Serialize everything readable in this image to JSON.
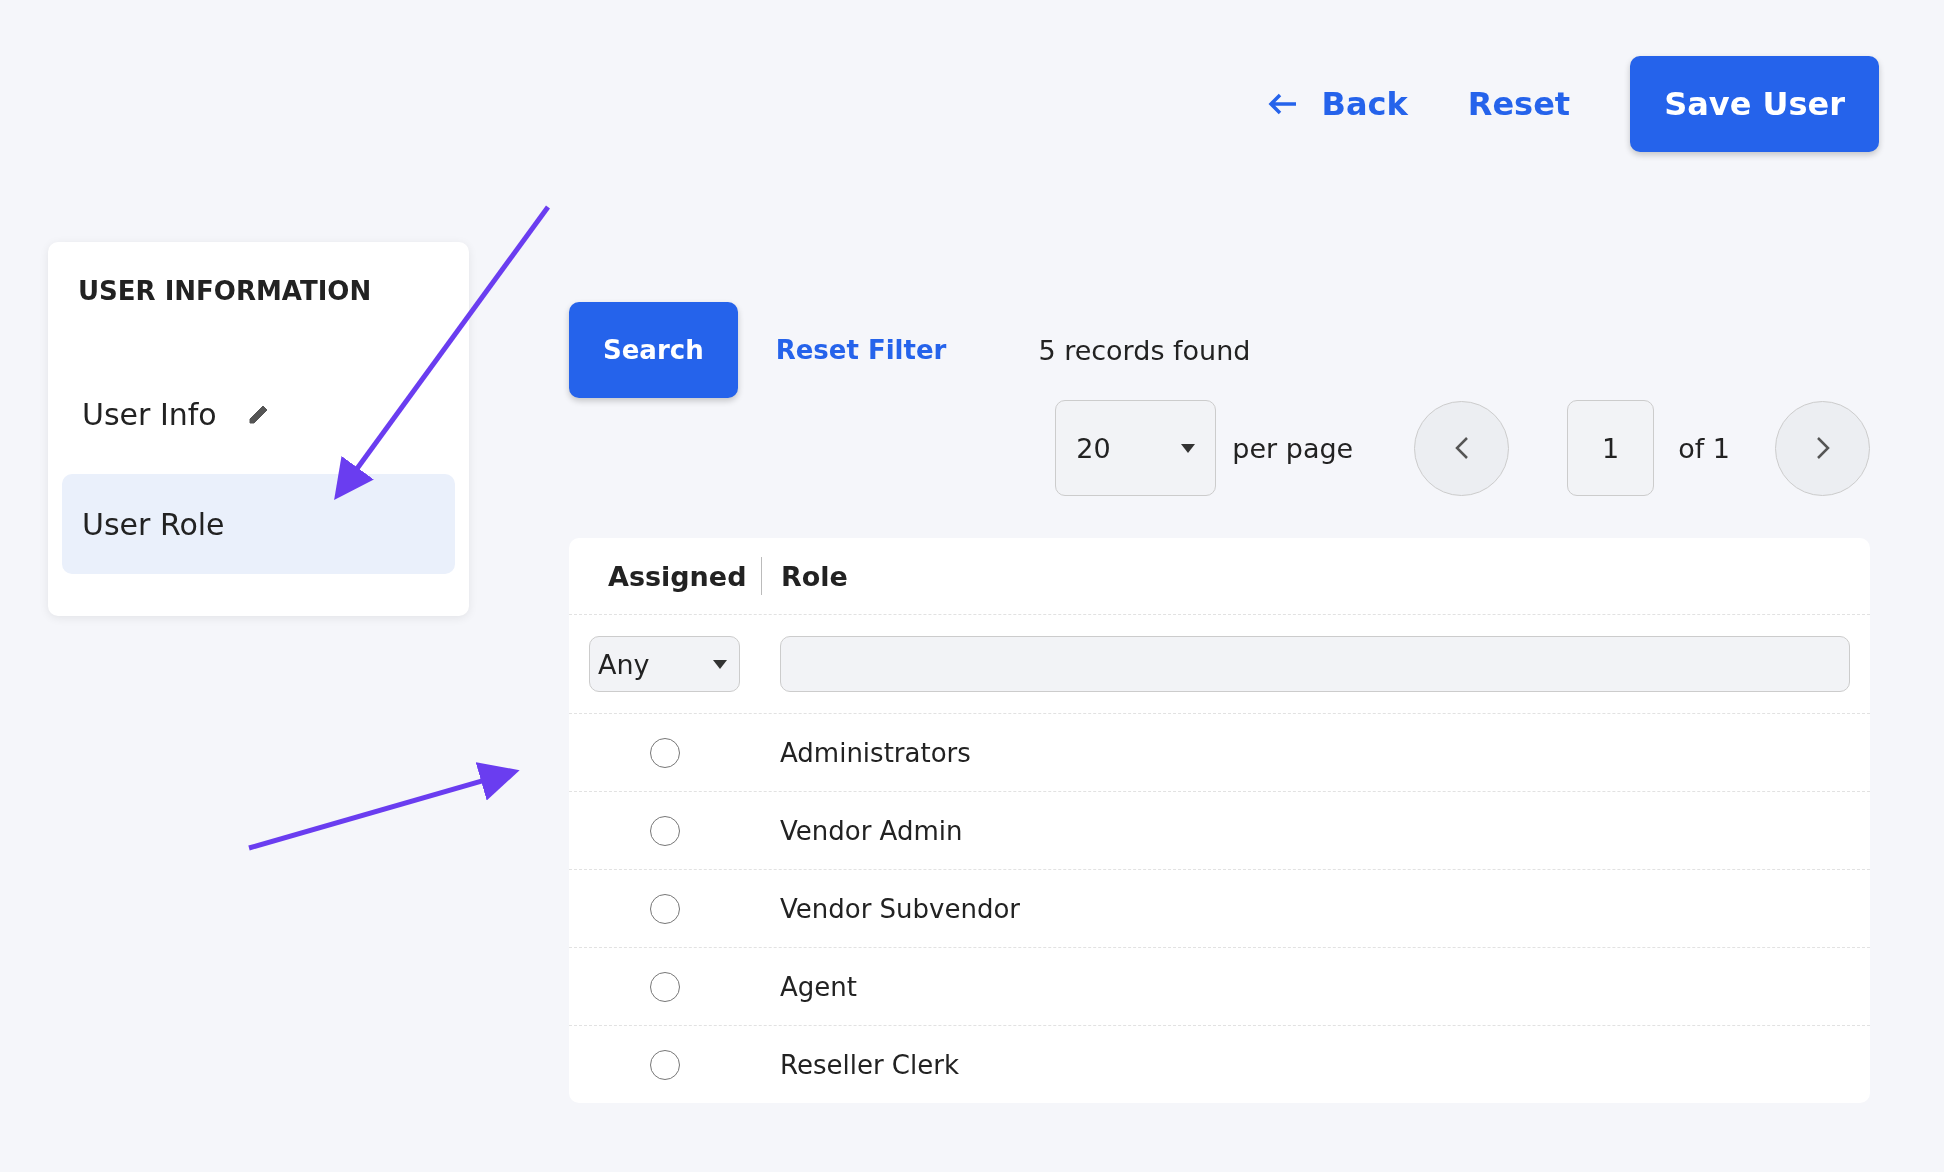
{
  "header": {
    "back": "Back",
    "reset": "Reset",
    "save": "Save User"
  },
  "sidebar": {
    "title": "USER INFORMATION",
    "items": [
      {
        "label": "User Info",
        "kind": "editable",
        "selected": false
      },
      {
        "label": "User Role",
        "kind": "plain",
        "selected": true
      }
    ]
  },
  "toolbar": {
    "search": "Search",
    "reset_filter": "Reset Filter",
    "records": "5 records found"
  },
  "pager": {
    "per_page": "20",
    "per_page_label": "per page",
    "page": "1",
    "of": "of 1"
  },
  "table": {
    "columns": [
      "Assigned",
      "Role"
    ],
    "assigned_filter": "Any",
    "rows": [
      {
        "role": "Administrators",
        "assigned": false
      },
      {
        "role": "Vendor Admin",
        "assigned": false
      },
      {
        "role": "Vendor Subvendor",
        "assigned": false
      },
      {
        "role": "Agent",
        "assigned": false
      },
      {
        "role": "Reseller Clerk",
        "assigned": false
      }
    ]
  }
}
